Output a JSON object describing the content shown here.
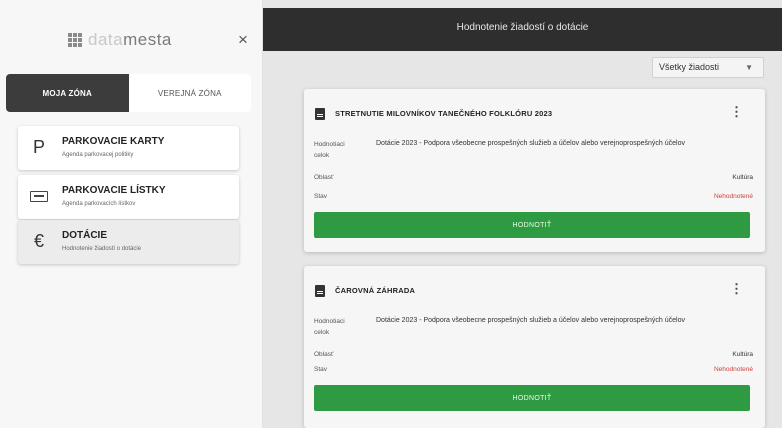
{
  "sidebar": {
    "logo": {
      "part1": "data",
      "part2": "mesta"
    },
    "close_icon": "×",
    "tabs": [
      "MOJA ZÓNA",
      "VEREJNÁ ZÓNA"
    ],
    "items": [
      {
        "icon": "P",
        "title": "PARKOVACIE KARTY",
        "subtitle": "Agenda parkovacej politiky"
      },
      {
        "icon": "ticket",
        "title": "PARKOVACIE LÍSTKY",
        "subtitle": "Agenda parkovacích lístkov"
      },
      {
        "icon": "€",
        "title": "DOTÁCIE",
        "subtitle": "Hodnotenie žiadostí o dotácie"
      }
    ]
  },
  "topbar": {
    "title": "Hodnotenie žiadostí o dotácie"
  },
  "filter": {
    "value": "Všetky žiadosti",
    "caret": "▼"
  },
  "applications": [
    {
      "title": "STRETNUTIE MILOVNÍKOV TANEČNÉHO FOLKLÓRU 2023",
      "labels": {
        "hodnotiaci": "Hodnotiaci",
        "celok": "celok",
        "oblast": "Oblasť",
        "stav": "Stav"
      },
      "program": "Dotácie 2023 - Podpora všeobecne prospešných služieb a účelov alebo verejnoprospešných účelov",
      "oblast": "Kultúra",
      "stav": "Nehodnotené",
      "button": "HODNOTIŤ"
    },
    {
      "title": "ČAROVNÁ ZÁHRADA",
      "labels": {
        "hodnotiaci": "Hodnotiaci",
        "celok": "celok",
        "oblast": "Oblasť",
        "stav": "Stav"
      },
      "program": "Dotácie 2023 - Podpora všeobecne prospešných služieb a účelov alebo verejnoprospešných účelov",
      "oblast": "Kultúra",
      "stav": "Nehodnotené",
      "button": "HODNOTIŤ"
    }
  ],
  "colors": {
    "accent_green": "#2e9a41",
    "status_red": "#d23f3f",
    "topbar": "#2e2e2e"
  }
}
